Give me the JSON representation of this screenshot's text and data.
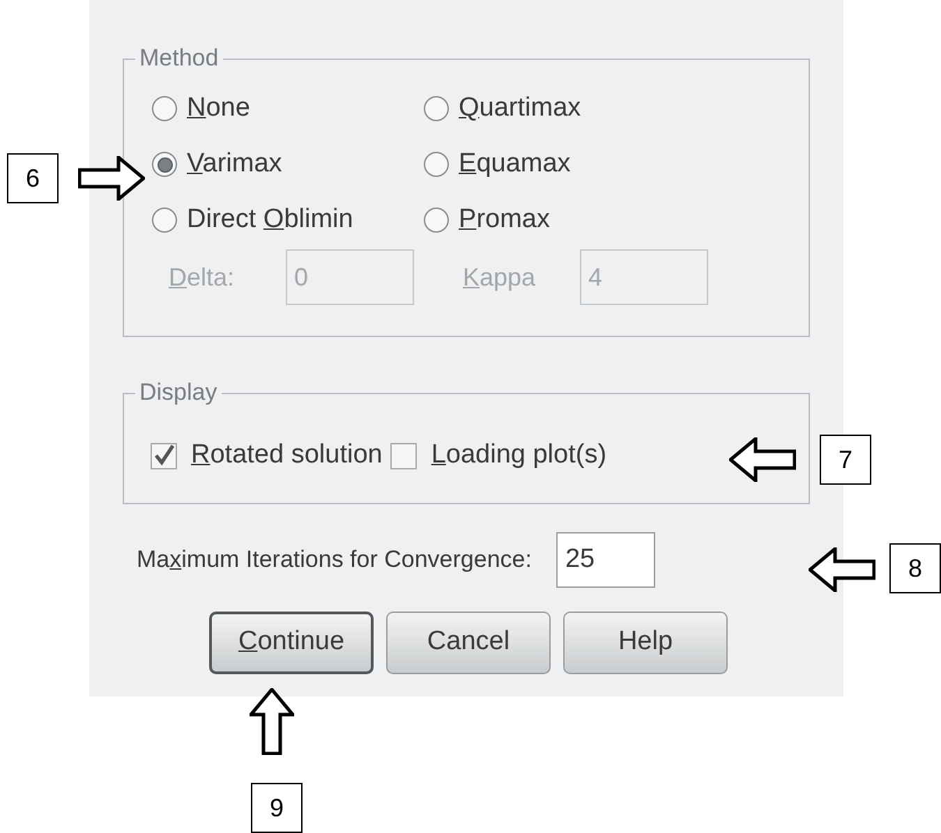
{
  "dialog": {
    "method": {
      "title": "Method",
      "options": [
        {
          "label": {
            "key": "N",
            "after": "one"
          },
          "selected": false
        },
        {
          "label": {
            "key": "Q",
            "after": "uartimax"
          },
          "selected": false
        },
        {
          "label": {
            "key": "V",
            "after": "arimax"
          },
          "selected": true
        },
        {
          "label": {
            "key": "E",
            "after": "quamax"
          },
          "selected": false
        },
        {
          "label": {
            "before": "Direct ",
            "key": "O",
            "after": "blimin"
          },
          "selected": false
        },
        {
          "label": {
            "key": "P",
            "after": "romax"
          },
          "selected": false
        }
      ],
      "params": [
        {
          "label": {
            "key": "D",
            "after": "elta:"
          },
          "value": "0",
          "disabled": true
        },
        {
          "label": {
            "key": "K",
            "after": "appa"
          },
          "value": "4",
          "disabled": true
        }
      ]
    },
    "display": {
      "title": "Display",
      "checkboxes": [
        {
          "label": {
            "key": "R",
            "after": "otated solution"
          },
          "checked": true
        },
        {
          "label": {
            "key": "L",
            "after": "oading plot(s)"
          },
          "checked": false
        }
      ]
    },
    "iterations": {
      "label": {
        "before": "Ma",
        "key": "x",
        "after": "imum Iterations for Convergence:"
      },
      "value": "25"
    },
    "buttons": [
      {
        "label": {
          "key": "C",
          "after": "ontinue"
        },
        "default": true
      },
      {
        "label": {
          "before": "Cancel"
        },
        "default": false
      },
      {
        "label": {
          "before": "Help"
        },
        "default": false
      }
    ]
  },
  "callouts": [
    {
      "number": "6",
      "kind": "right"
    },
    {
      "number": "7",
      "kind": "left"
    },
    {
      "number": "8",
      "kind": "left"
    },
    {
      "number": "9",
      "kind": "up"
    }
  ]
}
